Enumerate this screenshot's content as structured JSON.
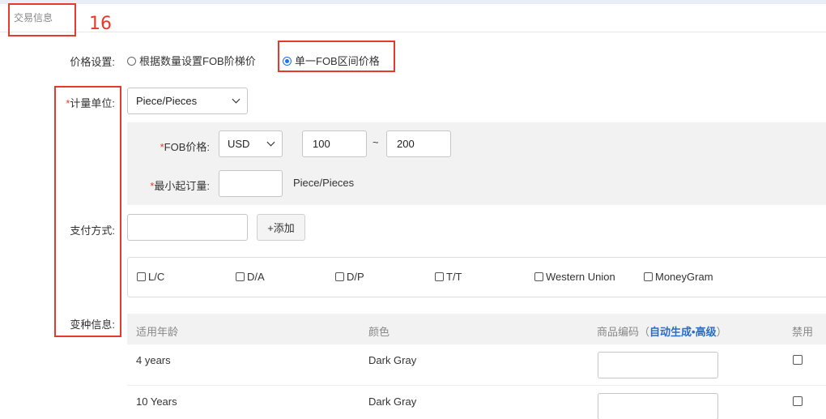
{
  "section": {
    "title": "交易信息",
    "annotation": "16"
  },
  "price_setting": {
    "label": "价格设置:",
    "options": [
      {
        "label": "根据数量设置FOB阶梯价",
        "selected": false
      },
      {
        "label": "单一FOB区间价格",
        "selected": true
      }
    ]
  },
  "unit": {
    "required_mark": "*",
    "label": "计量单位:",
    "value": "Piece/Pieces"
  },
  "fob": {
    "required_mark": "*",
    "label": "FOB价格:",
    "currency": "USD",
    "min": "100",
    "separator": "~",
    "max": "200"
  },
  "moq": {
    "required_mark": "*",
    "label": "最小起订量:",
    "value": "",
    "unit": "Piece/Pieces"
  },
  "payment": {
    "label": "支付方式:",
    "input_value": "",
    "add_button": "+添加",
    "options": [
      "L/C",
      "D/A",
      "D/P",
      "T/T",
      "Western Union",
      "MoneyGram"
    ]
  },
  "variants": {
    "label": "变种信息:",
    "headers": {
      "age": "适用年龄",
      "color": "颜色",
      "code": "商品编码",
      "code_open": "（",
      "code_auto": "自动生成",
      "code_dot": "•",
      "code_adv": "高级",
      "code_close": "）",
      "disable": "禁用"
    },
    "rows": [
      {
        "age": "4 years",
        "color": "Dark Gray",
        "code": "",
        "disabled": false
      },
      {
        "age": "10 Years",
        "color": "Dark Gray",
        "code": "",
        "disabled": false
      }
    ]
  },
  "colors": {
    "annotation_red": "#e53a2b",
    "link_blue": "#2b6cc4",
    "radio_blue": "#1a73e8"
  }
}
